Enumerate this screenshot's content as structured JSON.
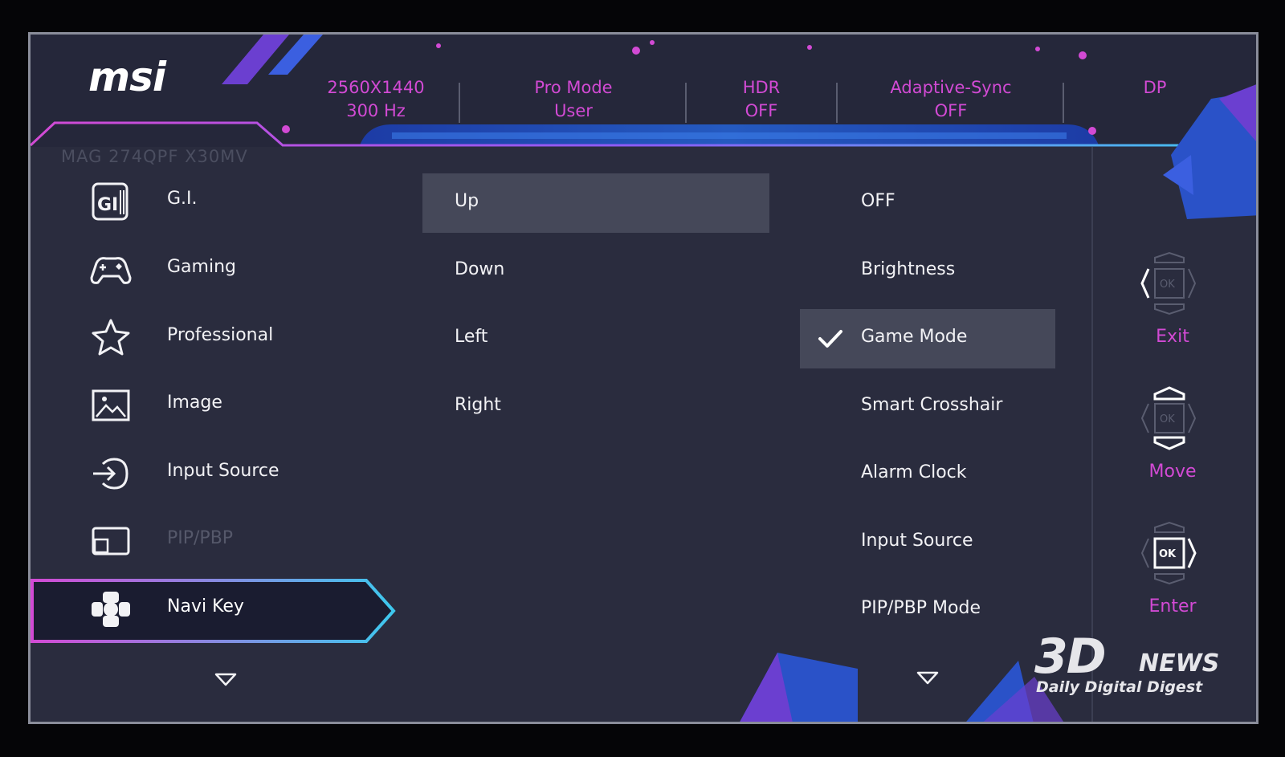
{
  "brand": {
    "logo": "msi",
    "model": "MAG 274QPF X30MV"
  },
  "status_bar": [
    {
      "line1": "2560X1440",
      "line2": "300 Hz"
    },
    {
      "line1": "Pro Mode",
      "line2": "User"
    },
    {
      "line1": "HDR",
      "line2": "OFF"
    },
    {
      "line1": "Adaptive-Sync",
      "line2": "OFF"
    },
    {
      "line1": "DP",
      "line2": ""
    }
  ],
  "main_menu": [
    {
      "label": "G.I.",
      "icon": "gi-icon",
      "state": "normal"
    },
    {
      "label": "Gaming",
      "icon": "gamepad-icon",
      "state": "normal"
    },
    {
      "label": "Professional",
      "icon": "star-icon",
      "state": "normal"
    },
    {
      "label": "Image",
      "icon": "image-icon",
      "state": "normal"
    },
    {
      "label": "Input Source",
      "icon": "input-source-icon",
      "state": "normal"
    },
    {
      "label": "PIP/PBP",
      "icon": "pip-icon",
      "state": "disabled"
    },
    {
      "label": "Navi Key",
      "icon": "navi-key-icon",
      "state": "selected"
    }
  ],
  "sub_menu": [
    {
      "label": "Up",
      "highlighted": true
    },
    {
      "label": "Down",
      "highlighted": false
    },
    {
      "label": "Left",
      "highlighted": false
    },
    {
      "label": "Right",
      "highlighted": false
    }
  ],
  "options": [
    {
      "label": "OFF",
      "checked": false,
      "highlighted": false
    },
    {
      "label": "Brightness",
      "checked": false,
      "highlighted": false
    },
    {
      "label": "Game Mode",
      "checked": true,
      "highlighted": true
    },
    {
      "label": "Smart Crosshair",
      "checked": false,
      "highlighted": false
    },
    {
      "label": "Alarm Clock",
      "checked": false,
      "highlighted": false
    },
    {
      "label": "Input Source",
      "checked": false,
      "highlighted": false
    },
    {
      "label": "PIP/PBP Mode",
      "checked": false,
      "highlighted": false
    }
  ],
  "nav_buttons": [
    {
      "label": "Exit",
      "icon": "joystick-left-icon"
    },
    {
      "label": "Move",
      "icon": "joystick-updown-icon"
    },
    {
      "label": "Enter",
      "icon": "joystick-press-icon"
    }
  ],
  "watermark": {
    "big": "3D",
    "news": "NEWS",
    "sub": "Daily Digital Digest"
  },
  "colors": {
    "accent": "#d24ad4",
    "background": "#2a2c3e",
    "highlight": "#454859",
    "cyan": "#3ec8ee"
  }
}
